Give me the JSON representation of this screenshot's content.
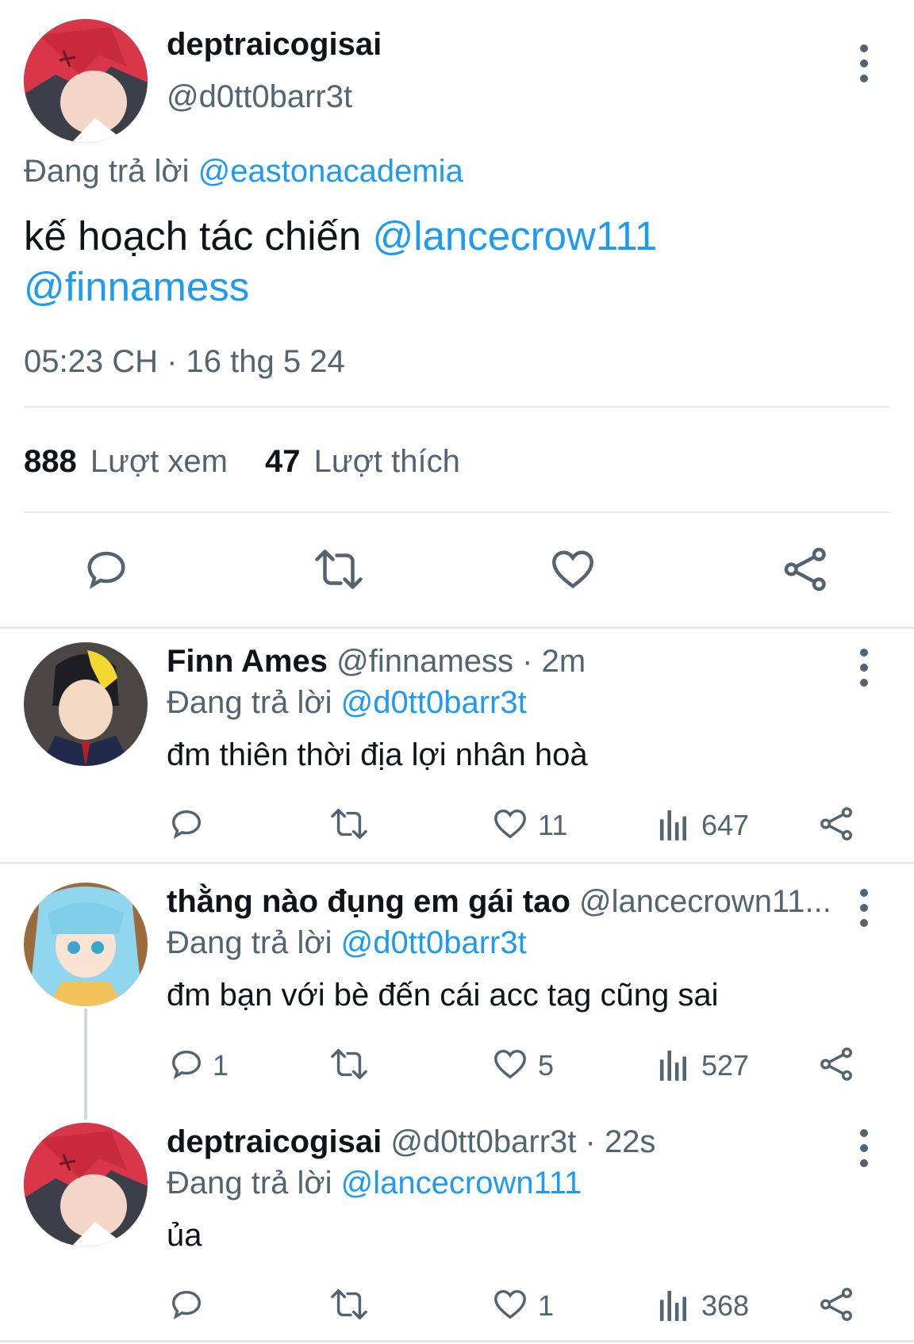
{
  "main_tweet": {
    "display_name": "deptraicogisai",
    "handle": "@d0tt0barr3t",
    "replying_prefix": "Đang trả lời",
    "replying_to": "@eastonacademia",
    "text_plain": "kế hoạch tác chiến",
    "mention_1": "@lancecrow111",
    "mention_2": "@finnamess",
    "timestamp": "05:23 CH · 16 thg 5 24",
    "views_count": "888",
    "views_label": "Lượt xem",
    "likes_count": "47",
    "likes_label": "Lượt thích",
    "actions": [
      "reply-icon",
      "retweet-icon",
      "like-icon",
      "share-icon"
    ]
  },
  "replies": [
    {
      "display_name": "Finn Ames",
      "handle_time": "@finnamess · 2m",
      "replying_prefix": "Đang trả lời",
      "replying_to": "@d0tt0barr3t",
      "text": "đm thiên thời địa lợi nhân hoà",
      "reply_count": "",
      "like_count": "11",
      "view_count": "647"
    },
    {
      "display_name": "thằng nào đụng em gái tao",
      "handle_time": "@lancecrown11...",
      "replying_prefix": "Đang trả lời",
      "replying_to": "@d0tt0barr3t",
      "text": "đm bạn với bè đến cái acc tag cũng sai",
      "reply_count": "1",
      "like_count": "5",
      "view_count": "527"
    },
    {
      "display_name": "deptraicogisai",
      "handle_time": "@d0tt0barr3t · 22s",
      "replying_prefix": "Đang trả lời",
      "replying_to": "@lancecrown111",
      "text": "ủa",
      "reply_count": "",
      "like_count": "1",
      "view_count": "368"
    }
  ],
  "colors": {
    "accent": "#1d9bf0",
    "secondary_text": "#536471",
    "primary_text": "#0f1419",
    "divider": "#e6e8ea"
  }
}
